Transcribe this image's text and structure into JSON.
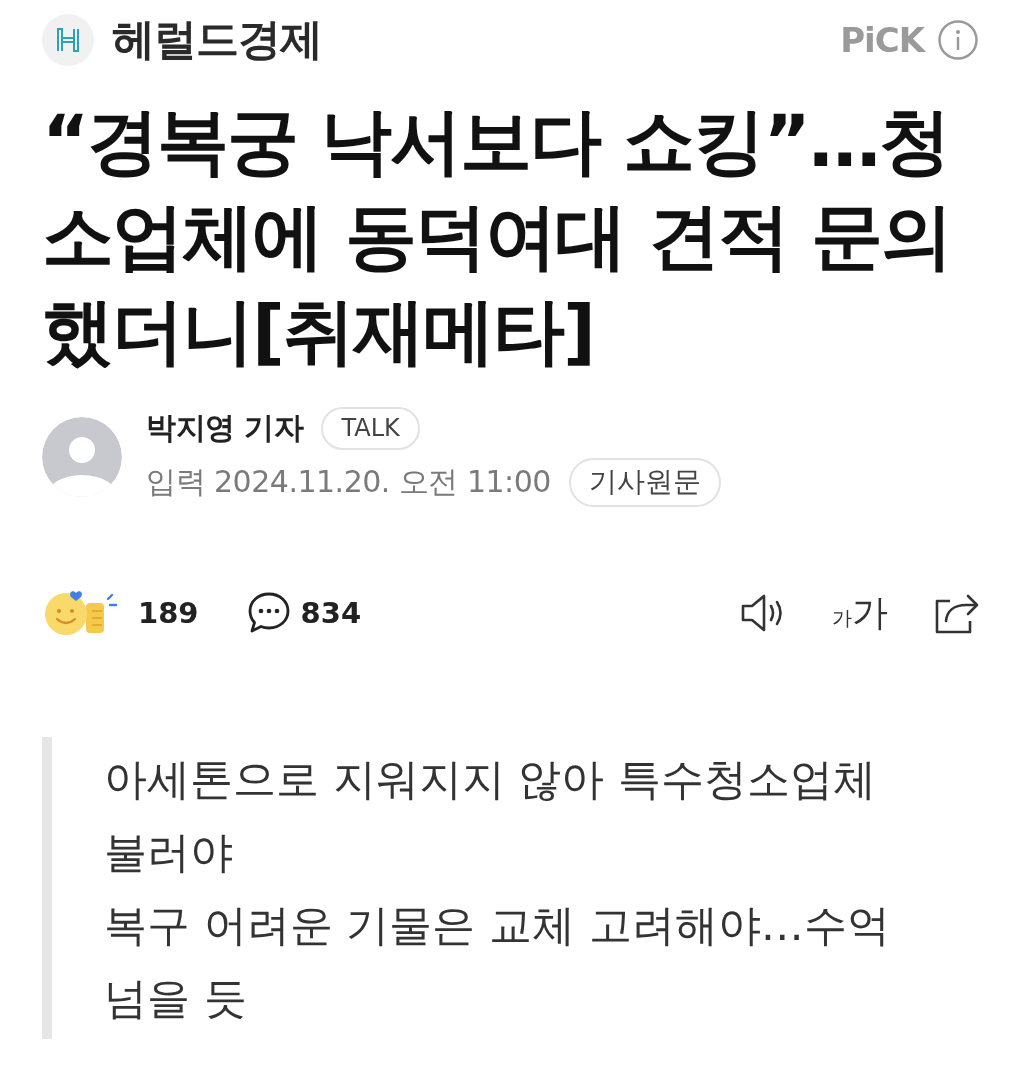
{
  "header": {
    "publisher": "헤럴드경제",
    "pick_label": "PiCK"
  },
  "headline": "“경복궁 낙서보다 쇼킹”…청소업체에 동덕여대 견적 문의했더니[취재메타]",
  "byline": {
    "author": "박지영 기자",
    "talk_button": "TALK",
    "date": "입력 2024.11.20. 오전 11:00",
    "original_button": "기사원문"
  },
  "actions": {
    "reactions": "189",
    "comments": "834",
    "font_size_button": {
      "small": "가",
      "large": "가"
    }
  },
  "summary": [
    "아세톤으로 지워지지 않아 특수청소업체 불러야",
    "복구 어려운 기물은 교체 고려해야…수억 넘을 듯"
  ]
}
